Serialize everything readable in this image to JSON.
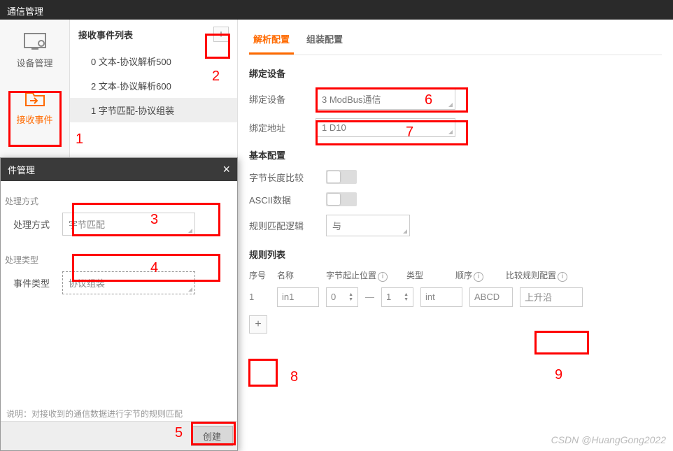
{
  "titlebar": "通信管理",
  "leftnav": {
    "device": "设备管理",
    "receive": "接收事件"
  },
  "eventlist": {
    "title": "接收事件列表",
    "items": [
      "0 文本-协议解析500",
      "2 文本-协议解析600",
      "1 字节匹配-协议组装"
    ]
  },
  "tabs": {
    "parse": "解析配置",
    "assemble": "组装配置"
  },
  "bind": {
    "section": "绑定设备",
    "dev_label": "绑定设备",
    "dev_value": "3 ModBus通信",
    "addr_label": "绑定地址",
    "addr_value": "1 D10"
  },
  "basic": {
    "section": "基本配置",
    "bytelen": "字节长度比较",
    "ascii": "ASCII数据",
    "logic_label": "规则匹配逻辑",
    "logic_value": "与"
  },
  "rules": {
    "section": "规则列表",
    "header": {
      "idx": "序号",
      "name": "名称",
      "range": "字节起止位置",
      "type": "类型",
      "order": "顺序",
      "comp": "比较规则配置"
    },
    "row": {
      "idx": "1",
      "name": "in1",
      "start": "0",
      "end": "1",
      "type": "int",
      "order": "ABCD",
      "comp": "上升沿"
    }
  },
  "modal": {
    "title": "件管理",
    "proc_group": "处理方式",
    "proc_label": "处理方式",
    "proc_value": "字节匹配",
    "type_group": "处理类型",
    "type_label": "事件类型",
    "type_value": "协议组装",
    "hint": "说明：对接收到的通信数据进行字节的规则匹配",
    "create": "创建"
  },
  "annotations": {
    "n1": "1",
    "n2": "2",
    "n3": "3",
    "n4": "4",
    "n5": "5",
    "n6": "6",
    "n7": "7",
    "n8": "8",
    "n9": "9"
  },
  "watermark": "CSDN @HuangGong2022"
}
